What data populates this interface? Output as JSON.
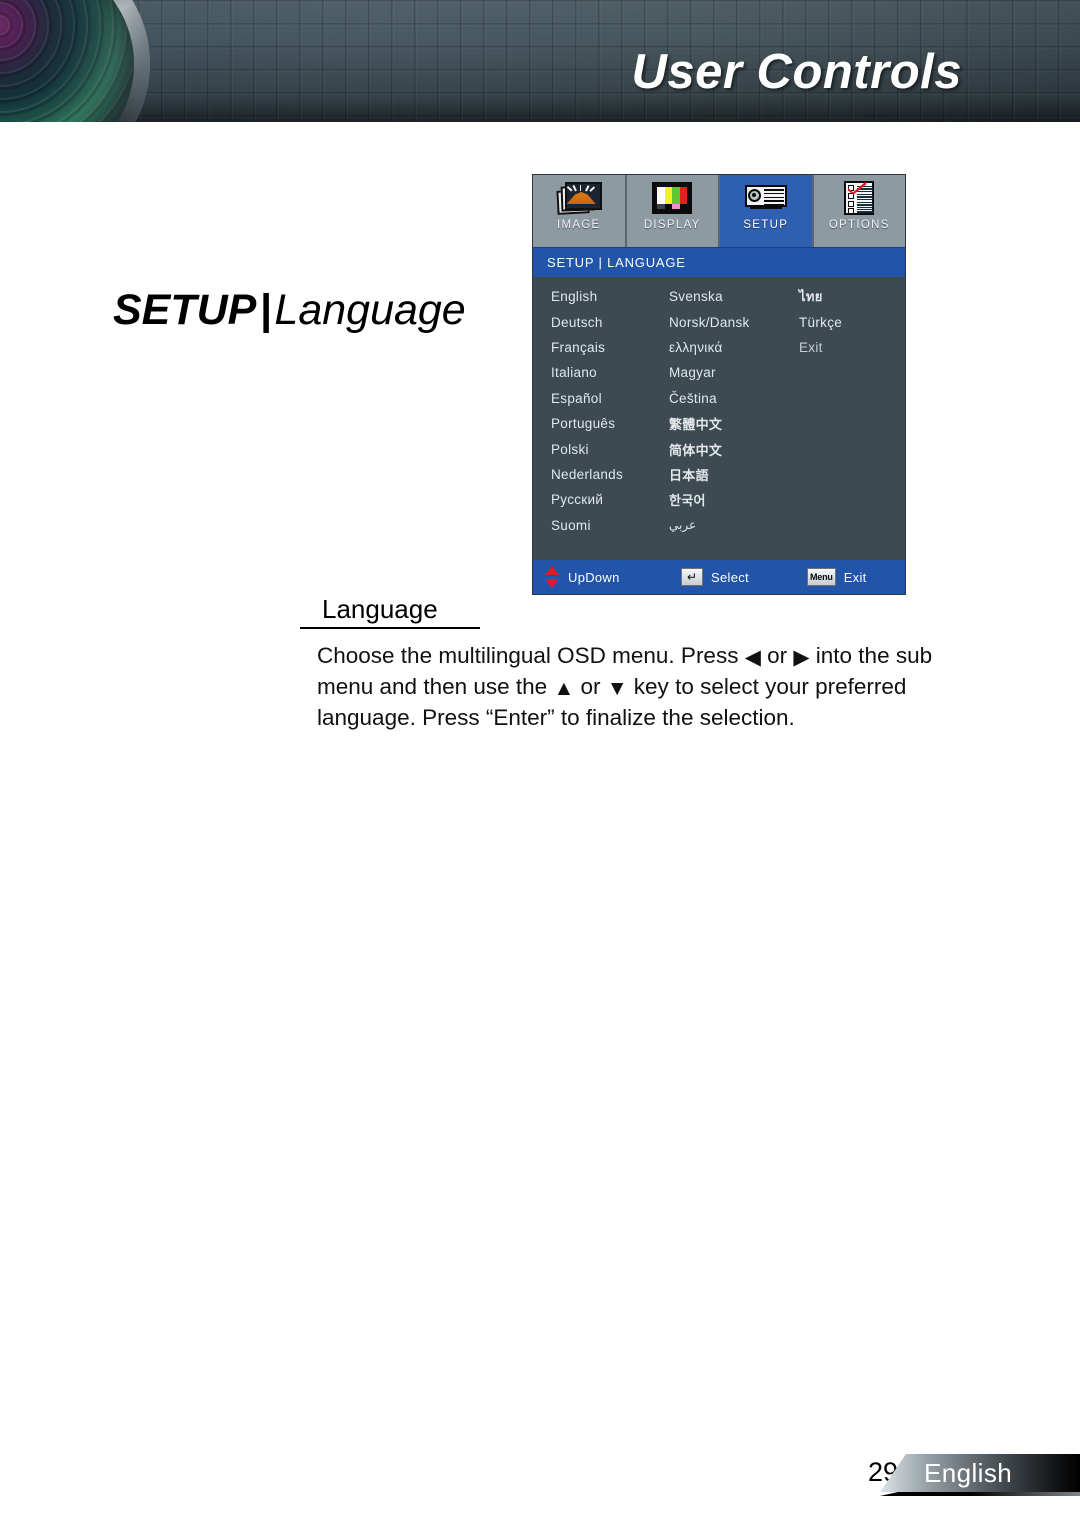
{
  "header": {
    "title": "User Controls",
    "lens_icon": "projector-lens-graphic"
  },
  "page_title": {
    "primary": "SETUP",
    "separator": "|",
    "secondary": "Language"
  },
  "osd": {
    "tabs": [
      {
        "label": "IMAGE",
        "icon": "image-icon",
        "active": false
      },
      {
        "label": "DISPLAY",
        "icon": "display-color-bars-icon",
        "active": false
      },
      {
        "label": "SETUP",
        "icon": "projector-setup-icon",
        "active": true
      },
      {
        "label": "OPTIONS",
        "icon": "options-checklist-icon",
        "active": false
      }
    ],
    "breadcrumb": "SETUP | LANGUAGE",
    "rows": [
      {
        "c1": "English",
        "c2": "Svenska",
        "c3": "ไทย"
      },
      {
        "c1": "Deutsch",
        "c2": "Norsk/Dansk",
        "c3": "Türkçe"
      },
      {
        "c1": "Français",
        "c2": "ελληνικά",
        "c3": "Exit"
      },
      {
        "c1": "Italiano",
        "c2": "Magyar",
        "c3": ""
      },
      {
        "c1": "Español",
        "c2": "Čeština",
        "c3": ""
      },
      {
        "c1": "Português",
        "c2": "繁體中文",
        "c3": ""
      },
      {
        "c1": "Polski",
        "c2": "简体中文",
        "c3": ""
      },
      {
        "c1": "Nederlands",
        "c2": "日本語",
        "c3": ""
      },
      {
        "c1": "Русский",
        "c2": "한국어",
        "c3": ""
      },
      {
        "c1": "Suomi",
        "c2": "عربي",
        "c3": ""
      }
    ],
    "footer": [
      {
        "icon": "up-down-arrows-icon",
        "key": "",
        "label": "UpDown"
      },
      {
        "icon": "enter-key-icon",
        "key": "↵",
        "label": "Select"
      },
      {
        "icon": "menu-key-icon",
        "key": "Menu",
        "label": "Exit"
      }
    ],
    "colors": {
      "accent_blue": "#2255aa",
      "tab_active_blue": "#2f5fb0",
      "panel_body": "#3d4a52",
      "tab_inactive": "#8d9aa1",
      "arrow_red": "#e01b24"
    }
  },
  "section": {
    "heading": "Language",
    "body_parts": {
      "p1": "Choose the multilingual OSD menu. Press ",
      "left_arrow": "◀",
      "p2": " or ",
      "right_arrow": "▶",
      "p3": " into the sub menu and then use the ",
      "up_arrow": "▲",
      "p4": " or ",
      "down_arrow": "▼",
      "p5": " key to select your preferred language. Press “Enter” to finalize the selection."
    }
  },
  "page_footer": {
    "page_number": "29",
    "language_label": "English"
  }
}
